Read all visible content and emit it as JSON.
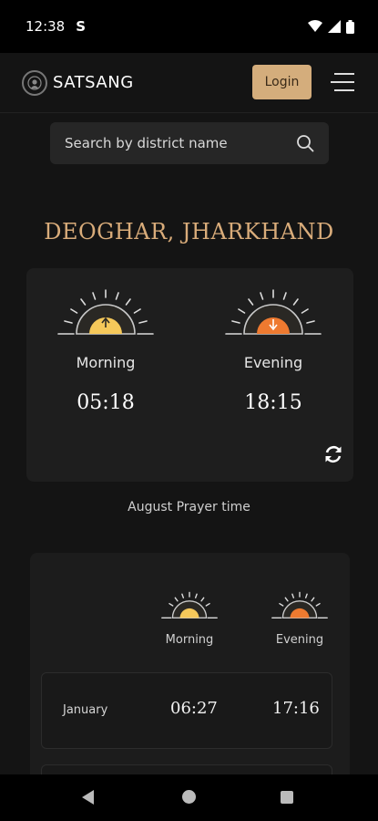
{
  "status_bar": {
    "time": "12:38",
    "sync_glyph": "S"
  },
  "app": {
    "brand": "SATSANG",
    "login_label": "Login"
  },
  "search": {
    "placeholder": "Search by district name"
  },
  "location": {
    "title": "DEOGHAR, JHARKHAND"
  },
  "today": {
    "morning_label": "Morning",
    "morning_time": "05:18",
    "evening_label": "Evening",
    "evening_time": "18:15"
  },
  "month_caption": "August Prayer time",
  "table": {
    "morning_header": "Morning",
    "evening_header": "Evening",
    "rows": [
      {
        "month": "January",
        "morning": "06:27",
        "evening": "17:16"
      }
    ]
  },
  "colors": {
    "accent": "#d9ac7a",
    "morning_sun": "#f5c85a",
    "evening_sun": "#ee7a30"
  },
  "icons": [
    "wifi-icon",
    "signal-icon",
    "battery-icon",
    "search-icon",
    "hamburger-icon",
    "refresh-icon",
    "sunrise-icon",
    "sunset-icon"
  ]
}
